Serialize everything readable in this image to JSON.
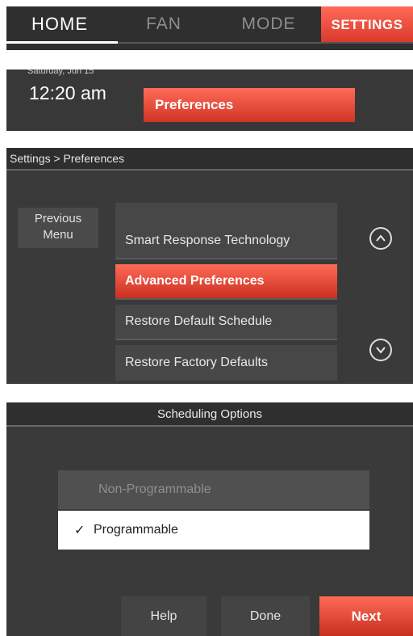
{
  "tabs": {
    "home": "HOME",
    "fan": "FAN",
    "mode": "MODE",
    "settings": "SETTINGS"
  },
  "status": {
    "date": "Saturday, Jun 15",
    "time": "12:20 am",
    "preferences_button": "Preferences"
  },
  "preferences_screen": {
    "breadcrumb": "Settings > Preferences",
    "previous_menu": "Previous Menu",
    "items": [
      {
        "label": "Smart Response Technology",
        "active": false
      },
      {
        "label": "Advanced Preferences",
        "active": true
      },
      {
        "label": "Restore Default Schedule",
        "active": false
      },
      {
        "label": "Restore Factory Defaults",
        "active": false
      }
    ],
    "scroll_up_icon": "chevron-up-circle-icon",
    "scroll_down_icon": "chevron-down-circle-icon"
  },
  "scheduling": {
    "title": "Scheduling Options",
    "options": [
      {
        "label": "Non-Programmable",
        "selected": false
      },
      {
        "label": "Programmable",
        "selected": true
      }
    ],
    "buttons": {
      "help": "Help",
      "done": "Done",
      "next": "Next"
    }
  },
  "colors": {
    "accent": "#e8483a",
    "panel_bg": "#3a3a3a",
    "selected_bg": "#ffffff"
  }
}
